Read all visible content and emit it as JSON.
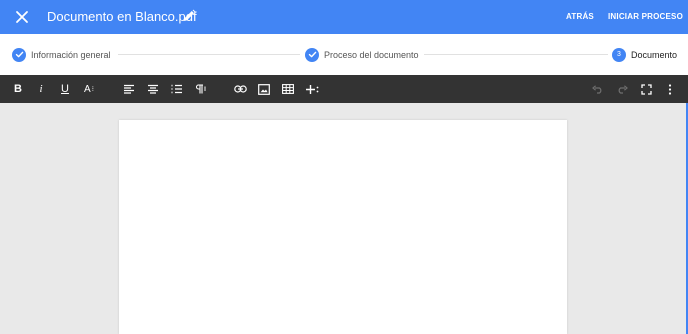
{
  "header": {
    "document_title": "Documento en Blanco.pdf",
    "back_label": "ATRÁS",
    "start_label": "INICIAR PROCESO",
    "close_icon": "close-icon",
    "edit_icon": "pencil-icon"
  },
  "stepper": {
    "steps": [
      {
        "label": "Información general",
        "state": "completed",
        "icon": "check-icon"
      },
      {
        "label": "Proceso del documento",
        "state": "completed",
        "icon": "check-icon"
      },
      {
        "label": "Documento",
        "state": "active",
        "number": "3"
      }
    ]
  },
  "toolbar": {
    "buttons": [
      {
        "name": "bold-button",
        "icon": "bold-icon",
        "label": "B"
      },
      {
        "name": "italic-button",
        "icon": "italic-icon",
        "label": "i"
      },
      {
        "name": "underline-button",
        "icon": "underline-icon",
        "label": "U"
      },
      {
        "name": "font-size-button",
        "icon": "font-size-icon",
        "label": "A"
      },
      {
        "name": "align-left-button",
        "icon": "align-left-icon"
      },
      {
        "name": "align-center-button",
        "icon": "align-center-icon"
      },
      {
        "name": "list-button",
        "icon": "ordered-list-icon"
      },
      {
        "name": "paragraph-button",
        "icon": "paragraph-icon"
      },
      {
        "name": "link-button",
        "icon": "link-icon"
      },
      {
        "name": "image-button",
        "icon": "image-icon"
      },
      {
        "name": "table-button",
        "icon": "table-icon"
      },
      {
        "name": "insert-more-button",
        "icon": "plus-icon"
      },
      {
        "name": "undo-button",
        "icon": "undo-icon",
        "disabled": true
      },
      {
        "name": "redo-button",
        "icon": "redo-icon",
        "disabled": true
      },
      {
        "name": "fullscreen-button",
        "icon": "fullscreen-icon"
      },
      {
        "name": "more-options-button",
        "icon": "more-vertical-icon"
      }
    ]
  },
  "colors": {
    "primary": "#4285f4",
    "toolbar": "#333333",
    "workspace": "#e9e9e9",
    "paper": "#ffffff"
  }
}
